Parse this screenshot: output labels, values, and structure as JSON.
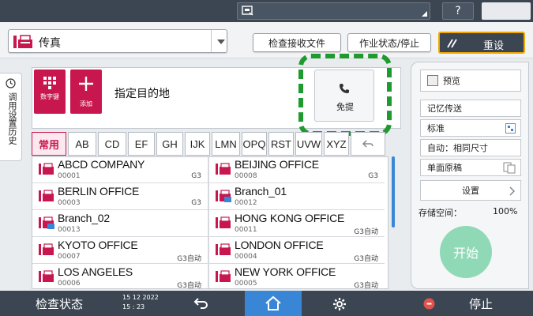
{
  "header": {
    "app_name": "传真",
    "check_received": "检查接收文件",
    "job_status": "作业状态/停止",
    "reset": "重设"
  },
  "side_tab": {
    "label": "调用设置历史"
  },
  "main": {
    "numeric_key_label": "数字键",
    "add_label": "添加",
    "destination_prompt": "指定目的地",
    "onhook_label": "免提"
  },
  "tabs": [
    "常用",
    "AB",
    "CD",
    "EF",
    "GH",
    "IJK",
    "LMN",
    "OPQ",
    "RST",
    "UVW",
    "XYZ"
  ],
  "contacts": [
    {
      "name": "ABCD COMPANY",
      "number": "00001",
      "mode": "G3"
    },
    {
      "name": "BEIJING OFFICE",
      "number": "00008",
      "mode": "G3"
    },
    {
      "name": "BERLIN OFFICE",
      "number": "00003",
      "mode": "G3"
    },
    {
      "name": "Branch_01",
      "number": "00012",
      "mode": ""
    },
    {
      "name": "Branch_02",
      "number": "00013",
      "mode": ""
    },
    {
      "name": "HONG KONG OFFICE",
      "number": "00011",
      "mode": "G3自动"
    },
    {
      "name": "KYOTO OFFICE",
      "number": "00007",
      "mode": "G3自动"
    },
    {
      "name": "LONDON OFFICE",
      "number": "00004",
      "mode": "G3自动"
    },
    {
      "name": "LOS ANGELES",
      "number": "00006",
      "mode": "G3自动"
    },
    {
      "name": "NEW YORK OFFICE",
      "number": "00005",
      "mode": "G3自动"
    }
  ],
  "right_panel": {
    "preview": "预览",
    "memory_transmission": "记忆传送",
    "resolution": "标准",
    "size": "自动：相同尺寸",
    "duplex": "单面原稿",
    "settings": "设置",
    "storage_label": "存储空间：",
    "storage_value": "100%",
    "start": "开始"
  },
  "bottombar": {
    "check_status": "检查状态",
    "date": "15 12 2022",
    "time": "15 : 23",
    "stop": "停止"
  },
  "topbar": {
    "help": "?"
  },
  "colors": {
    "accent_red": "#c8174f",
    "highlight_green": "#1f9a2e",
    "start_green": "#8fd9b6",
    "dark_bar": "#3c4653",
    "home_blue": "#3a86d6",
    "reset_border": "#f0a800"
  }
}
